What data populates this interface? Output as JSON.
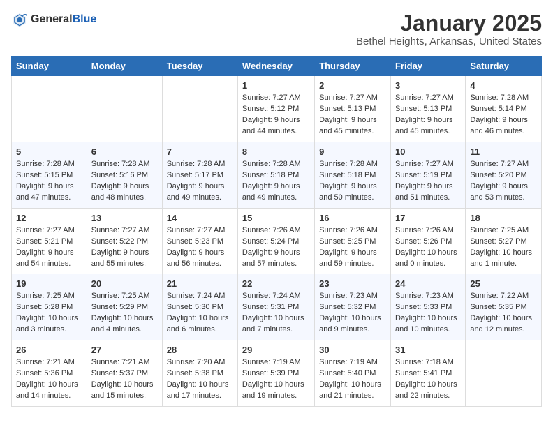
{
  "logo": {
    "general": "General",
    "blue": "Blue"
  },
  "title": "January 2025",
  "location": "Bethel Heights, Arkansas, United States",
  "days_of_week": [
    "Sunday",
    "Monday",
    "Tuesday",
    "Wednesday",
    "Thursday",
    "Friday",
    "Saturday"
  ],
  "weeks": [
    [
      {
        "day": "",
        "info": ""
      },
      {
        "day": "",
        "info": ""
      },
      {
        "day": "",
        "info": ""
      },
      {
        "day": "1",
        "info": "Sunrise: 7:27 AM\nSunset: 5:12 PM\nDaylight: 9 hours\nand 44 minutes."
      },
      {
        "day": "2",
        "info": "Sunrise: 7:27 AM\nSunset: 5:13 PM\nDaylight: 9 hours\nand 45 minutes."
      },
      {
        "day": "3",
        "info": "Sunrise: 7:27 AM\nSunset: 5:13 PM\nDaylight: 9 hours\nand 45 minutes."
      },
      {
        "day": "4",
        "info": "Sunrise: 7:28 AM\nSunset: 5:14 PM\nDaylight: 9 hours\nand 46 minutes."
      }
    ],
    [
      {
        "day": "5",
        "info": "Sunrise: 7:28 AM\nSunset: 5:15 PM\nDaylight: 9 hours\nand 47 minutes."
      },
      {
        "day": "6",
        "info": "Sunrise: 7:28 AM\nSunset: 5:16 PM\nDaylight: 9 hours\nand 48 minutes."
      },
      {
        "day": "7",
        "info": "Sunrise: 7:28 AM\nSunset: 5:17 PM\nDaylight: 9 hours\nand 49 minutes."
      },
      {
        "day": "8",
        "info": "Sunrise: 7:28 AM\nSunset: 5:18 PM\nDaylight: 9 hours\nand 49 minutes."
      },
      {
        "day": "9",
        "info": "Sunrise: 7:28 AM\nSunset: 5:18 PM\nDaylight: 9 hours\nand 50 minutes."
      },
      {
        "day": "10",
        "info": "Sunrise: 7:27 AM\nSunset: 5:19 PM\nDaylight: 9 hours\nand 51 minutes."
      },
      {
        "day": "11",
        "info": "Sunrise: 7:27 AM\nSunset: 5:20 PM\nDaylight: 9 hours\nand 53 minutes."
      }
    ],
    [
      {
        "day": "12",
        "info": "Sunrise: 7:27 AM\nSunset: 5:21 PM\nDaylight: 9 hours\nand 54 minutes."
      },
      {
        "day": "13",
        "info": "Sunrise: 7:27 AM\nSunset: 5:22 PM\nDaylight: 9 hours\nand 55 minutes."
      },
      {
        "day": "14",
        "info": "Sunrise: 7:27 AM\nSunset: 5:23 PM\nDaylight: 9 hours\nand 56 minutes."
      },
      {
        "day": "15",
        "info": "Sunrise: 7:26 AM\nSunset: 5:24 PM\nDaylight: 9 hours\nand 57 minutes."
      },
      {
        "day": "16",
        "info": "Sunrise: 7:26 AM\nSunset: 5:25 PM\nDaylight: 9 hours\nand 59 minutes."
      },
      {
        "day": "17",
        "info": "Sunrise: 7:26 AM\nSunset: 5:26 PM\nDaylight: 10 hours\nand 0 minutes."
      },
      {
        "day": "18",
        "info": "Sunrise: 7:25 AM\nSunset: 5:27 PM\nDaylight: 10 hours\nand 1 minute."
      }
    ],
    [
      {
        "day": "19",
        "info": "Sunrise: 7:25 AM\nSunset: 5:28 PM\nDaylight: 10 hours\nand 3 minutes."
      },
      {
        "day": "20",
        "info": "Sunrise: 7:25 AM\nSunset: 5:29 PM\nDaylight: 10 hours\nand 4 minutes."
      },
      {
        "day": "21",
        "info": "Sunrise: 7:24 AM\nSunset: 5:30 PM\nDaylight: 10 hours\nand 6 minutes."
      },
      {
        "day": "22",
        "info": "Sunrise: 7:24 AM\nSunset: 5:31 PM\nDaylight: 10 hours\nand 7 minutes."
      },
      {
        "day": "23",
        "info": "Sunrise: 7:23 AM\nSunset: 5:32 PM\nDaylight: 10 hours\nand 9 minutes."
      },
      {
        "day": "24",
        "info": "Sunrise: 7:23 AM\nSunset: 5:33 PM\nDaylight: 10 hours\nand 10 minutes."
      },
      {
        "day": "25",
        "info": "Sunrise: 7:22 AM\nSunset: 5:35 PM\nDaylight: 10 hours\nand 12 minutes."
      }
    ],
    [
      {
        "day": "26",
        "info": "Sunrise: 7:21 AM\nSunset: 5:36 PM\nDaylight: 10 hours\nand 14 minutes."
      },
      {
        "day": "27",
        "info": "Sunrise: 7:21 AM\nSunset: 5:37 PM\nDaylight: 10 hours\nand 15 minutes."
      },
      {
        "day": "28",
        "info": "Sunrise: 7:20 AM\nSunset: 5:38 PM\nDaylight: 10 hours\nand 17 minutes."
      },
      {
        "day": "29",
        "info": "Sunrise: 7:19 AM\nSunset: 5:39 PM\nDaylight: 10 hours\nand 19 minutes."
      },
      {
        "day": "30",
        "info": "Sunrise: 7:19 AM\nSunset: 5:40 PM\nDaylight: 10 hours\nand 21 minutes."
      },
      {
        "day": "31",
        "info": "Sunrise: 7:18 AM\nSunset: 5:41 PM\nDaylight: 10 hours\nand 22 minutes."
      },
      {
        "day": "",
        "info": ""
      }
    ]
  ]
}
